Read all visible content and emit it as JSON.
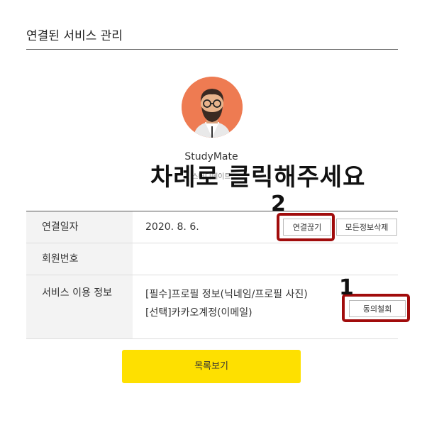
{
  "page": {
    "title": "연결된 서비스 관리"
  },
  "service": {
    "name": "StudyMate",
    "subtitle": "스터디메이트"
  },
  "overlay": {
    "instruction": "차례로 클릭해주세요",
    "step1": "1",
    "step2": "2"
  },
  "table": {
    "rows": [
      {
        "label": "연결일자",
        "value": "2020. 8. 6."
      },
      {
        "label": "회원번호",
        "value": ""
      },
      {
        "label": "서비스 이용 정보",
        "lines": [
          "[필수]프로필 정보(닉네임/프로필 사진)",
          "[선택]카카오계정(이메일)"
        ]
      }
    ]
  },
  "buttons": {
    "disconnect": "연결끊기",
    "delete_all": "모든정보삭제",
    "withdraw": "동의철회",
    "list": "목록보기"
  },
  "colors": {
    "accent_yellow": "#fee000",
    "avatar_bg": "#ee7b52",
    "highlight_red": "#a10c0c"
  },
  "icons": {
    "avatar": "bearded-man-avatar"
  }
}
